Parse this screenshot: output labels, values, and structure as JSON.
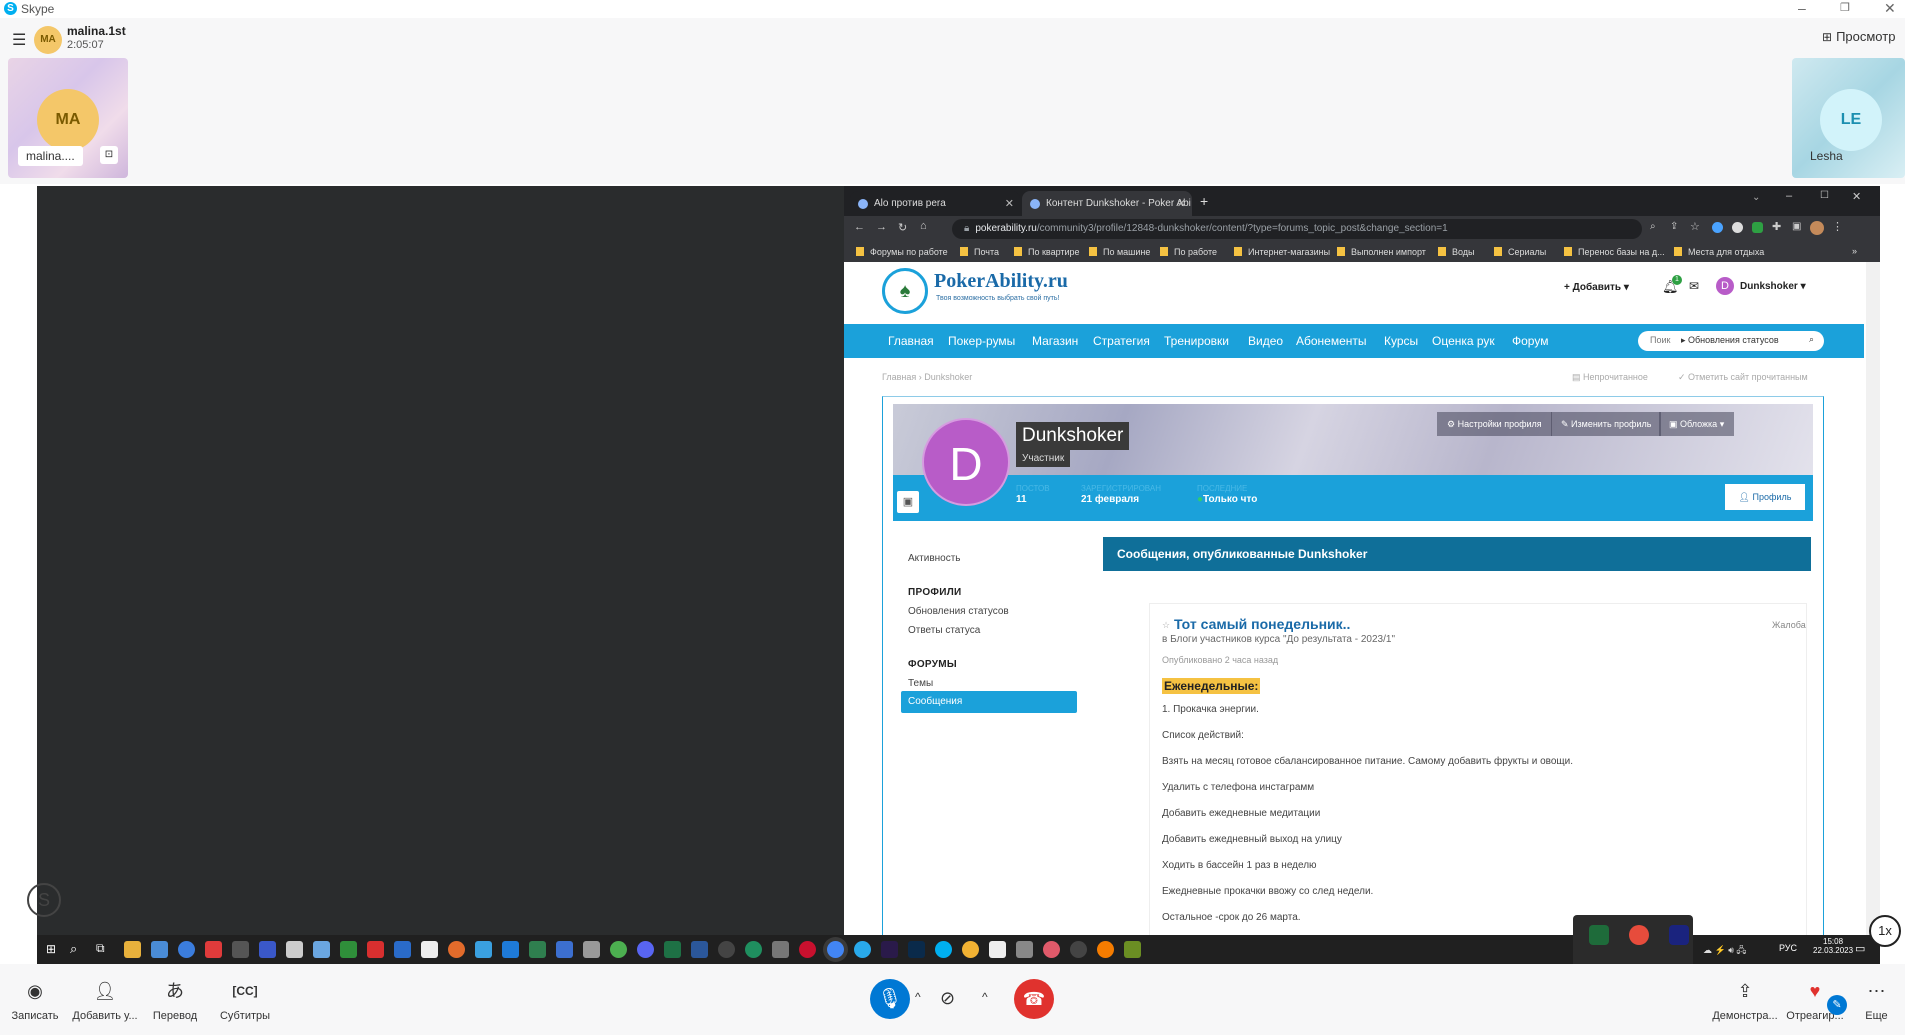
{
  "window": {
    "title": "Skype"
  },
  "call": {
    "caller_initials": "MA",
    "caller_name": "malina.1st",
    "duration": "2:05:07",
    "view_button": "Просмотр",
    "participants": [
      {
        "initials": "MA",
        "name": "malina...."
      },
      {
        "initials": "LE",
        "name": "Lesha"
      }
    ],
    "zoom": "1x"
  },
  "browser": {
    "tabs": [
      {
        "label": "Alo против pera"
      },
      {
        "label": "Контент Dunkshoker - Poker Abi"
      }
    ],
    "url_host": "pokerability.ru",
    "url_path": "/community3/profile/12848-dunkshoker/content/?type=forums_topic_post&change_section=1",
    "bookmarks": [
      "Форумы по работе",
      "Почта",
      "По квартире",
      "По машине",
      "По работе",
      "Интернет-магазины",
      "Выполнен импорт",
      "Воды",
      "Сериалы",
      "Перенос базы на д...",
      "Места для отдыха"
    ]
  },
  "site": {
    "logo_text": "PokerAbility.ru",
    "logo_tagline": "Твоя возможность выбрать свой путь!",
    "add_label": "Добавить",
    "notif_count": "1",
    "user_initial": "D",
    "user_name": "Dunkshoker",
    "nav": [
      "Главная",
      "Покер-румы",
      "Магазин",
      "Стратегия",
      "Тренировки",
      "Видео",
      "Абонементы",
      "Курсы",
      "Оценка рук",
      "Форум"
    ],
    "search_placeholder": "Поик",
    "search_filter": "Обновления статусов",
    "breadcrumb": [
      "Главная",
      "Dunkshoker"
    ],
    "unread_link": "Непрочитанное",
    "mark_read_link": "Отметить сайт прочитанным"
  },
  "profile": {
    "initial": "D",
    "name": "Dunkshoker",
    "role": "Участник",
    "settings_btn": "Настройки профиля",
    "edit_btn": "Изменить профиль",
    "cover_btn": "Обложка",
    "profile_btn": "Профиль",
    "stats": [
      {
        "label": "ПОСТОВ",
        "value": "11"
      },
      {
        "label": "ЗАРЕГИСТРИРОВАН",
        "value": "21 февраля"
      },
      {
        "label": "ПОСЛЕДНИЕ",
        "value": "Только что"
      }
    ]
  },
  "sidebar": {
    "activity": "Активность",
    "profiles_head": "ПРОФИЛИ",
    "status_updates": "Обновления статусов",
    "status_replies": "Ответы статуса",
    "forums_head": "ФОРУМЫ",
    "topics": "Темы",
    "posts": "Сообщения"
  },
  "content": {
    "section_title": "Сообщения, опубликованные Dunkshoker",
    "post_title": "Тот самый понедельник..",
    "post_location": "в Блоги участников курса \"До результата - 2023/1\"",
    "report": "Жалоба",
    "posted": "Опубликовано 2 часа назад",
    "highlight": "Еженедельные:",
    "lines": [
      "1. Прокачка энергии.",
      "Список действий:",
      "Взять на месяц готовое сбалансированное питание. Самому добавить фрукты и овощи.",
      "Удалить с телефона инстаграмм",
      "Добавить ежедневные медитации",
      "Добавить ежедневный выход на улицу",
      "Ходить в бассейн 1 раз в неделю",
      "Ежедневные прокачки ввожу со след недели.",
      "Остальное -срок до 26 марта."
    ]
  },
  "taskbar": {
    "lang": "РУС",
    "time": "15:08",
    "date": "22.03.2023"
  },
  "controls": {
    "record": "Записать",
    "add": "Добавить у...",
    "translate": "Перевод",
    "subtitles": "Субтитры",
    "share": "Демонстра...",
    "react": "Отреагир...",
    "more": "Еще"
  }
}
